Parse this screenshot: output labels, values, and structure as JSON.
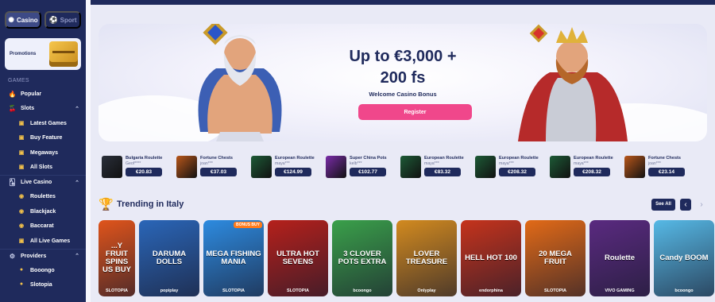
{
  "sidebar": {
    "tabs": [
      {
        "label": "Casino",
        "icon": "casino-chip-icon",
        "active": true
      },
      {
        "label": "Sport",
        "icon": "soccer-ball-icon",
        "active": false
      }
    ],
    "promotions_label": "Promotions",
    "games_section_label": "GAMES",
    "items": [
      {
        "label": "Popular",
        "icon": "fire-icon"
      },
      {
        "label": "Slots",
        "icon": "cherry-icon",
        "expanded": true
      },
      {
        "label": "Latest Games",
        "icon": "latest-games-icon"
      },
      {
        "label": "Buy Feature",
        "icon": "buy-feature-icon"
      },
      {
        "label": "Megaways",
        "icon": "megaways-icon"
      },
      {
        "label": "All Slots",
        "icon": "all-slots-icon"
      },
      {
        "label": "Live Casino",
        "icon": "live-casino-icon",
        "expanded": true
      },
      {
        "label": "Roulettes",
        "icon": "roulette-icon"
      },
      {
        "label": "Blackjack",
        "icon": "blackjack-icon"
      },
      {
        "label": "Baccarat",
        "icon": "baccarat-icon"
      },
      {
        "label": "All Live Games",
        "icon": "all-live-games-icon"
      },
      {
        "label": "Providers",
        "icon": "providers-icon",
        "expanded": true
      },
      {
        "label": "Booongo",
        "icon": "booongo-icon"
      },
      {
        "label": "Slotopia",
        "icon": "slotopia-icon"
      }
    ]
  },
  "hero": {
    "title_line1": "Up to €3,000 +",
    "title_line2": "200 fs",
    "subtitle": "Welcome Casino Bonus",
    "cta": "Register",
    "cta_color": "#f0478b"
  },
  "recent_wins": [
    {
      "game": "Bulgaria Roulette",
      "user": "Geof****",
      "amount": "€20.83",
      "thumb": "#2a2f3a"
    },
    {
      "game": "Fortune Chests",
      "user": "joan***",
      "amount": "€37.03",
      "thumb": "#b8561a"
    },
    {
      "game": "European Roulette",
      "user": "maya***",
      "amount": "€124.99",
      "thumb": "#1d5a36"
    },
    {
      "game": "Super China Pots",
      "user": "kelb***",
      "amount": "€102.77",
      "thumb": "#7a2ca8"
    },
    {
      "game": "European Roulette",
      "user": "maya***",
      "amount": "€83.32",
      "thumb": "#1d5a36"
    },
    {
      "game": "European Roulette",
      "user": "maya***",
      "amount": "€208.32",
      "thumb": "#1d5a36"
    },
    {
      "game": "European Roulette",
      "user": "maya***",
      "amount": "€208.32",
      "thumb": "#1d5a36"
    },
    {
      "game": "Fortune Chests",
      "user": "joan***",
      "amount": "€23.14",
      "thumb": "#b8561a"
    }
  ],
  "trending": {
    "title": "Trending in Italy",
    "see_all": "See All",
    "prev_icon": "chevron-left-icon",
    "next_icon": "chevron-right-icon",
    "games": [
      {
        "title": "...Y FRUIT SPINS US BUY",
        "provider": "SLOTOPIA",
        "bg": "#e0541b",
        "partial": true
      },
      {
        "title": "DARUMA DOLLS",
        "provider": "popiplay",
        "bg": "#2a66b8"
      },
      {
        "title": "MEGA FISHING MANIA",
        "provider": "SLOTOPIA",
        "bg": "#2d8be0",
        "badge": "BONUS BUY"
      },
      {
        "title": "ULTRA HOT SEVENS",
        "provider": "SLOTOPIA",
        "bg": "#b5201b"
      },
      {
        "title": "3 CLOVER POTS EXTRA",
        "provider": "bcoongo",
        "bg": "#3aa04a"
      },
      {
        "title": "LOVER TREASURE",
        "provider": "Onlyplay",
        "bg": "#d28a1f"
      },
      {
        "title": "HELL HOT 100",
        "provider": "endorphina",
        "bg": "#c5331c"
      },
      {
        "title": "20 MEGA FRUIT",
        "provider": "SLOTOPIA",
        "bg": "#e26a17"
      },
      {
        "title": "Roulette",
        "provider": "VIVO GAMING",
        "bg": "#5a2a80"
      },
      {
        "title": "Candy BOOM",
        "provider": "bcoongo",
        "bg": "#56b9e6"
      }
    ]
  }
}
